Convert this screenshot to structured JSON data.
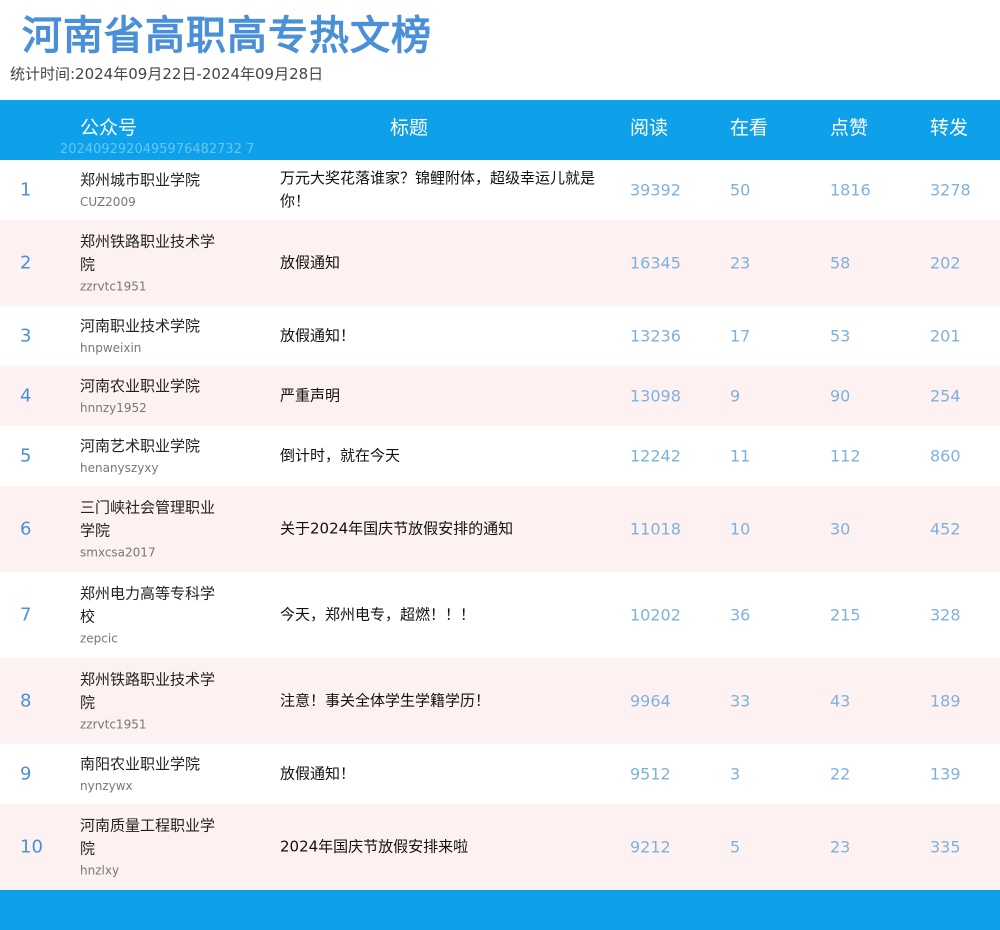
{
  "page": {
    "title": "河南省高职高专热文榜",
    "period": "统计时间:2024年09月22日-2024年09月28日"
  },
  "header": {
    "account": "公众号",
    "title": "标题",
    "read": "阅读",
    "watch": "在看",
    "like": "点赞",
    "share": "转发",
    "watermark": "2024092920495976482732 7"
  },
  "rows": [
    {
      "rank": "1",
      "name": "郑州城市职业学院",
      "id": "CUZ2009",
      "title": "万元大奖花落谁家？锦鲤附体，超级幸运儿就是你！",
      "read": "39392",
      "watch": "50",
      "like": "1816",
      "share": "3278"
    },
    {
      "rank": "2",
      "name": "郑州铁路职业技术学院",
      "id": "zzrvtc1951",
      "title": "放假通知",
      "read": "16345",
      "watch": "23",
      "like": "58",
      "share": "202"
    },
    {
      "rank": "3",
      "name": "河南职业技术学院",
      "id": "hnpweixin",
      "title": "放假通知！",
      "read": "13236",
      "watch": "17",
      "like": "53",
      "share": "201"
    },
    {
      "rank": "4",
      "name": "河南农业职业学院",
      "id": "hnnzy1952",
      "title": "严重声明",
      "read": "13098",
      "watch": "9",
      "like": "90",
      "share": "254"
    },
    {
      "rank": "5",
      "name": "河南艺术职业学院",
      "id": "henanyszyxy",
      "title": "倒计时，就在今天",
      "read": "12242",
      "watch": "11",
      "like": "112",
      "share": "860"
    },
    {
      "rank": "6",
      "name": "三门峡社会管理职业学院",
      "id": "smxcsa2017",
      "title": "关于2024年国庆节放假安排的通知",
      "read": "11018",
      "watch": "10",
      "like": "30",
      "share": "452"
    },
    {
      "rank": "7",
      "name": "郑州电力高等专科学校",
      "id": "zepcic",
      "title": "今天，郑州电专，超燃！！！",
      "read": "10202",
      "watch": "36",
      "like": "215",
      "share": "328"
    },
    {
      "rank": "8",
      "name": "郑州铁路职业技术学院",
      "id": "zzrvtc1951",
      "title": "注意！事关全体学生学籍学历！",
      "read": "9964",
      "watch": "33",
      "like": "43",
      "share": "189"
    },
    {
      "rank": "9",
      "name": "南阳农业职业学院",
      "id": "nynzywx",
      "title": "放假通知！",
      "read": "9512",
      "watch": "3",
      "like": "22",
      "share": "139"
    },
    {
      "rank": "10",
      "name": "河南质量工程职业学院",
      "id": "hnzlxy",
      "title": "2024年国庆节放假安排来啦",
      "read": "9212",
      "watch": "5",
      "like": "23",
      "share": "335"
    }
  ]
}
